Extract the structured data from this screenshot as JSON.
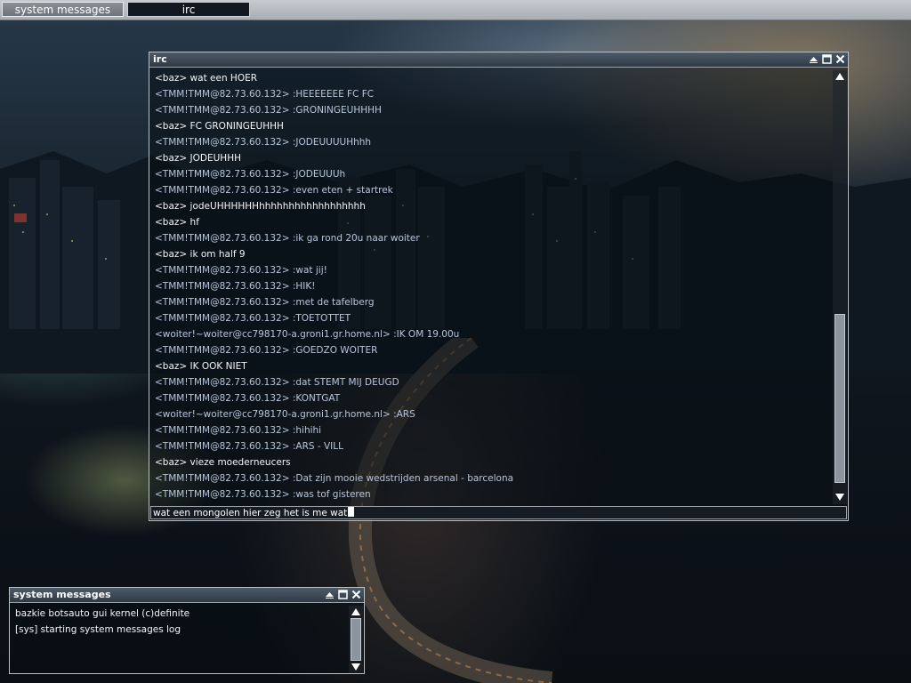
{
  "taskbar": {
    "tabs": [
      {
        "label": "system messages",
        "state": "inactive"
      },
      {
        "label": "irc",
        "state": "active"
      }
    ]
  },
  "irc_window": {
    "title": "irc",
    "messages": [
      {
        "kind": "baz",
        "text": "<baz> wat een HOER"
      },
      {
        "kind": "tmm",
        "text": "<TMM!TMM@82.73.60.132> :HEEEEEEE FC FC"
      },
      {
        "kind": "tmm",
        "text": "<TMM!TMM@82.73.60.132> :GRONINGEUHHHH"
      },
      {
        "kind": "baz",
        "text": "<baz> FC GRONINGEUHHH"
      },
      {
        "kind": "tmm",
        "text": "<TMM!TMM@82.73.60.132> :JODEUUUUHhhh"
      },
      {
        "kind": "baz",
        "text": "<baz> JODEUHHH"
      },
      {
        "kind": "tmm",
        "text": "<TMM!TMM@82.73.60.132> :JODEUUUh"
      },
      {
        "kind": "tmm",
        "text": "<TMM!TMM@82.73.60.132> :even eten + startrek"
      },
      {
        "kind": "baz",
        "text": "<baz> jodeUHHHHHHhhhhhhhhhhhhhhhhhh"
      },
      {
        "kind": "baz",
        "text": "<baz> hf"
      },
      {
        "kind": "tmm",
        "text": "<TMM!TMM@82.73.60.132> :ik ga rond 20u naar woiter"
      },
      {
        "kind": "baz",
        "text": "<baz> ik om half 9"
      },
      {
        "kind": "tmm",
        "text": "<TMM!TMM@82.73.60.132> :wat jij!"
      },
      {
        "kind": "tmm",
        "text": "<TMM!TMM@82.73.60.132> :HIK!"
      },
      {
        "kind": "tmm",
        "text": "<TMM!TMM@82.73.60.132> :met de tafelberg"
      },
      {
        "kind": "tmm",
        "text": "<TMM!TMM@82.73.60.132> :TOETOTTET"
      },
      {
        "kind": "woiter",
        "text": "<woiter!~woiter@cc798170-a.groni1.gr.home.nl> :IK OM 19.00u"
      },
      {
        "kind": "tmm",
        "text": "<TMM!TMM@82.73.60.132> :GOEDZO WOITER"
      },
      {
        "kind": "baz",
        "text": "<baz> IK OOK NIET"
      },
      {
        "kind": "tmm",
        "text": "<TMM!TMM@82.73.60.132> :dat STEMT MIJ DEUGD"
      },
      {
        "kind": "tmm",
        "text": "<TMM!TMM@82.73.60.132> :KONTGAT"
      },
      {
        "kind": "woiter",
        "text": "<woiter!~woiter@cc798170-a.groni1.gr.home.nl> :ARS"
      },
      {
        "kind": "tmm",
        "text": "<TMM!TMM@82.73.60.132> :hihihi"
      },
      {
        "kind": "tmm",
        "text": "<TMM!TMM@82.73.60.132> :ARS - VILL"
      },
      {
        "kind": "baz",
        "text": "<baz> vieze moederneucers"
      },
      {
        "kind": "tmm",
        "text": "<TMM!TMM@82.73.60.132> :Dat zijn mooie wedstrijden arsenal - barcelona"
      },
      {
        "kind": "tmm",
        "text": "<TMM!TMM@82.73.60.132> :was tof gisteren"
      }
    ],
    "input_value": "wat een mongolen hier zeg het is me wat"
  },
  "sys_window": {
    "title": "system messages",
    "messages": [
      "bazkie botsauto gui kernel (c)definite",
      "[sys] starting system messages log"
    ]
  },
  "icons": {
    "minimize": "minimize-icon",
    "maximize": "maximize-icon",
    "close": "close-icon",
    "scroll_up": "scroll-up-arrow-icon",
    "scroll_down": "scroll-down-arrow-icon"
  },
  "colors": {
    "tmm_text": "#b8c6dc",
    "baz_text": "#f4f6f8",
    "title_bar": "#3a4652"
  }
}
